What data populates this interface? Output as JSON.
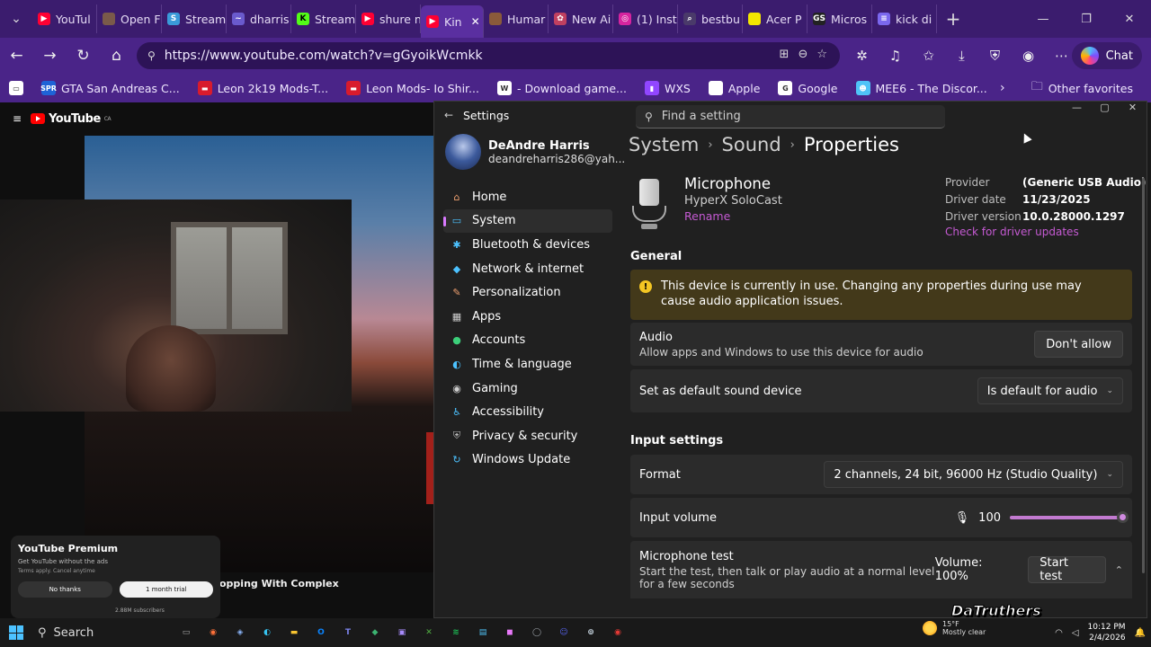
{
  "browser": {
    "tabs": [
      {
        "label": "YouTul",
        "color": "#ff0033",
        "glyph": "▶"
      },
      {
        "label": "Open F",
        "color": "#7a5a4a",
        "glyph": ""
      },
      {
        "label": "Stream",
        "color": "#3a9ad9",
        "glyph": "S"
      },
      {
        "label": "dharris",
        "color": "#6a5acd",
        "glyph": "~"
      },
      {
        "label": "Stream",
        "color": "#53fc18",
        "glyph": "K"
      },
      {
        "label": "shure n",
        "color": "#ff0033",
        "glyph": "▶"
      },
      {
        "label": "Kin",
        "color": "#ff0033",
        "glyph": "▶",
        "active": true
      },
      {
        "label": "Humar",
        "color": "#8a5a3a",
        "glyph": ""
      },
      {
        "label": "New Ai",
        "color": "#c04060",
        "glyph": "✿"
      },
      {
        "label": "(1) Inst",
        "color": "#d6249f",
        "glyph": "◎"
      },
      {
        "label": "bestbu",
        "color": "#4a3a6a",
        "glyph": "⌕"
      },
      {
        "label": "Acer P",
        "color": "#f3e600",
        "glyph": ""
      },
      {
        "label": "Micros",
        "color": "#222222",
        "glyph": "GS"
      },
      {
        "label": "kick di",
        "color": "#7b68ee",
        "glyph": "≡"
      }
    ],
    "url": "https://www.youtube.com/watch?v=gGyoikWcmkk",
    "chat_label": "Chat",
    "favorites": [
      {
        "label": "",
        "color": "#ffffff",
        "glyph": "▭"
      },
      {
        "label": "GTA San Andreas C...",
        "color": "#1e63d6",
        "glyph": "SPR"
      },
      {
        "label": "Leon 2k19 Mods-T...",
        "color": "#d81b2c",
        "glyph": "▬"
      },
      {
        "label": "Leon Mods- Io Shir...",
        "color": "#d81b2c",
        "glyph": "▬"
      },
      {
        "label": "- Download game...",
        "color": "#ffffff",
        "glyph": "W"
      },
      {
        "label": "WXS",
        "color": "#9146ff",
        "glyph": "▮"
      },
      {
        "label": "Apple",
        "color": "#ffffff",
        "glyph": ""
      },
      {
        "label": "Google",
        "color": "#ffffff",
        "glyph": "G"
      },
      {
        "label": "MEE6 - The Discor...",
        "color": "#4fc3f7",
        "glyph": "☻"
      }
    ],
    "other_favorites": "Other favorites"
  },
  "youtube": {
    "logo_text": "YouTube",
    "logo_country": "CA",
    "video_title_fragment": "opping With Complex",
    "premium": {
      "title": "YouTube Premium",
      "subtitle": "Get YouTube without the ads",
      "terms": "Terms apply. Cancel anytime",
      "no_label": "No thanks",
      "yes_label": "1 month trial"
    },
    "subscribers": "2.88M subscribers"
  },
  "settings": {
    "window_title": "Settings",
    "search_placeholder": "Find a setting",
    "user": {
      "name": "DeAndre Harris",
      "email": "deandreharris286@yah..."
    },
    "nav": [
      {
        "label": "Home",
        "icon": "home-icon",
        "glyph": "⌂",
        "color": "#f0a070"
      },
      {
        "label": "System",
        "icon": "system-icon",
        "glyph": "▭",
        "color": "#4cc2ff",
        "active": true
      },
      {
        "label": "Bluetooth & devices",
        "icon": "bluetooth-icon",
        "glyph": "✱",
        "color": "#4cc2ff"
      },
      {
        "label": "Network & internet",
        "icon": "network-icon",
        "glyph": "◆",
        "color": "#4cc2ff"
      },
      {
        "label": "Personalization",
        "icon": "brush-icon",
        "glyph": "✎",
        "color": "#f0a070"
      },
      {
        "label": "Apps",
        "icon": "apps-icon",
        "glyph": "▦",
        "color": "#cfcfcf"
      },
      {
        "label": "Accounts",
        "icon": "accounts-icon",
        "glyph": "●",
        "color": "#3ccf7a"
      },
      {
        "label": "Time & language",
        "icon": "globe-icon",
        "glyph": "◐",
        "color": "#4cc2ff"
      },
      {
        "label": "Gaming",
        "icon": "gaming-icon",
        "glyph": "◉",
        "color": "#cfcfcf"
      },
      {
        "label": "Accessibility",
        "icon": "accessibility-icon",
        "glyph": "♿",
        "color": "#4cc2ff"
      },
      {
        "label": "Privacy & security",
        "icon": "shield-icon",
        "glyph": "⛨",
        "color": "#bbbbbb"
      },
      {
        "label": "Windows Update",
        "icon": "update-icon",
        "glyph": "↻",
        "color": "#4cc2ff"
      }
    ],
    "breadcrumb": [
      "System",
      "Sound",
      "Properties"
    ],
    "device": {
      "name": "Microphone",
      "model": "HyperX SoloCast",
      "rename": "Rename"
    },
    "driver": {
      "provider_label": "Provider",
      "provider": "(Generic USB Audio)",
      "date_label": "Driver date",
      "date": "11/23/2025",
      "version_label": "Driver version",
      "version": "10.0.28000.1297",
      "update_link": "Check for driver updates"
    },
    "general_heading": "General",
    "warning": "This device is currently in use. Changing any properties during use may cause audio application issues.",
    "audio": {
      "title": "Audio",
      "desc": "Allow apps and Windows to use this device for audio",
      "button": "Don't allow"
    },
    "default_device": {
      "title": "Set as default sound device",
      "value": "Is default for audio"
    },
    "input_heading": "Input settings",
    "format": {
      "title": "Format",
      "value": "2 channels, 24 bit, 96000 Hz (Studio Quality)"
    },
    "input_volume": {
      "title": "Input volume",
      "value": "100",
      "level": 1.0
    },
    "mic_test": {
      "title": "Microphone test",
      "desc": "Start the test, then talk or play audio at a normal level for a few seconds",
      "volume": "Volume: 100%",
      "button": "Start test"
    }
  },
  "taskbar": {
    "search_label": "Search",
    "weather_temp": "15°F",
    "weather_desc": "Mostly clear",
    "time": "10:12 PM",
    "date": "2/4/2026"
  },
  "watermark": "DaTruthers"
}
